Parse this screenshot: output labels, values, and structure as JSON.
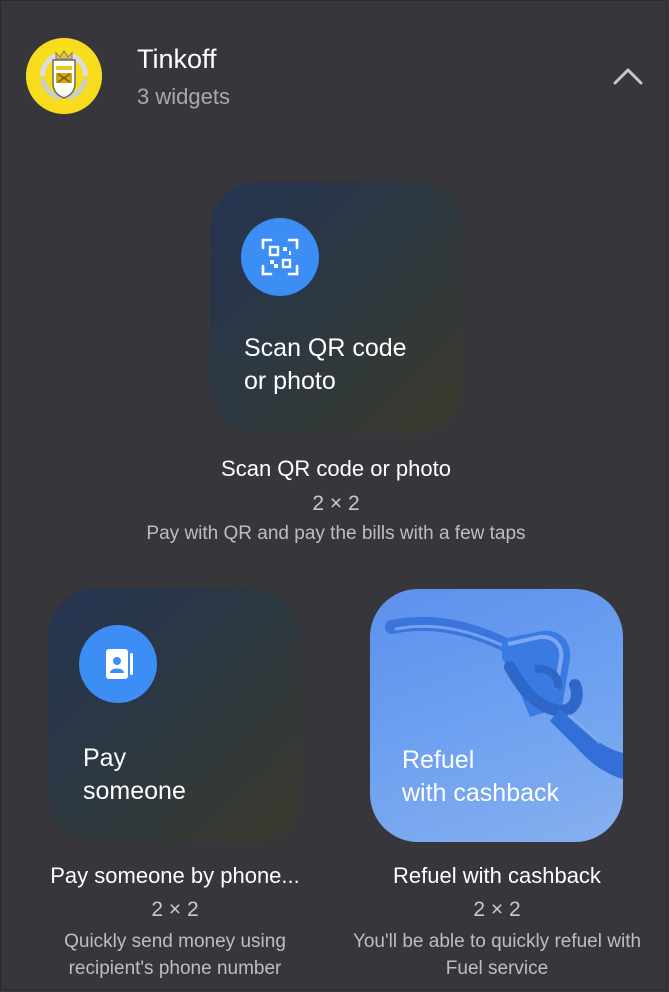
{
  "header": {
    "app_name": "Tinkoff",
    "widget_count": "3 widgets",
    "logo_icon": "tinkoff-crest-icon",
    "collapse_icon": "chevron-up-icon"
  },
  "colors": {
    "background": "#37363b",
    "logo_yellow": "#f7dd1b",
    "icon_blue": "#3c8ef5",
    "refuel_card": "#6b9ff0"
  },
  "widgets": [
    {
      "card_label": "Scan QR code\nor photo",
      "title": "Scan QR code or photo",
      "size": "2 × 2",
      "description": "Pay with QR and pay the bills with a few taps",
      "icon": "qr-scan-icon"
    },
    {
      "card_label": "Pay\nsomeone",
      "title": "Pay someone by phone...",
      "size": "2 × 2",
      "description": "Quickly send money using recipient's phone number",
      "icon": "contact-card-icon"
    },
    {
      "card_label": "Refuel\nwith cashback",
      "title": "Refuel with cashback",
      "size": "2 × 2",
      "description": "You'll be able to quickly refuel with Fuel service",
      "icon": "fuel-nozzle-icon"
    }
  ]
}
